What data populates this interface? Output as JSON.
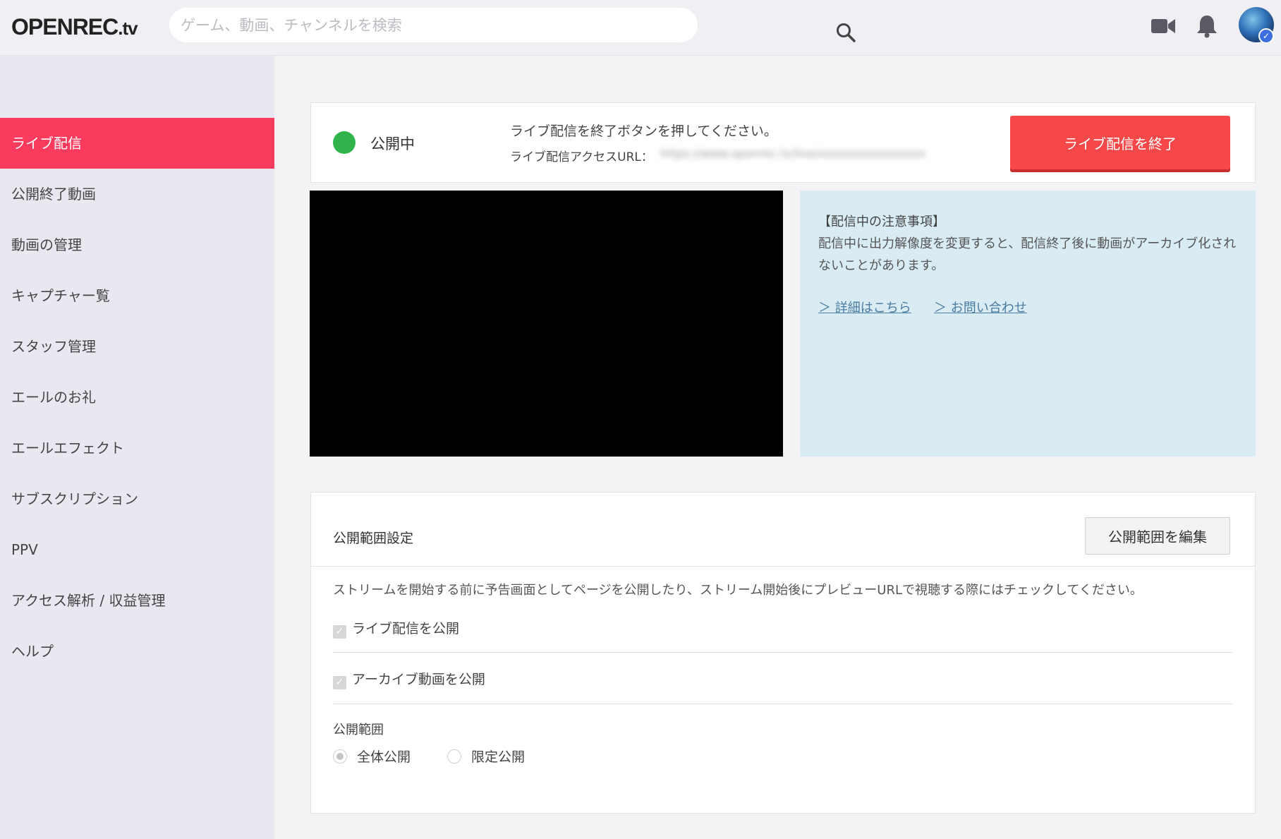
{
  "header": {
    "logo_main": "OPENREC",
    "logo_tld": ".tv",
    "search_placeholder": "ゲーム、動画、チャンネルを検索",
    "badge_check": "✓"
  },
  "sidebar": {
    "items": [
      {
        "label": "ライブ配信",
        "active": true
      },
      {
        "label": "公開終了動画"
      },
      {
        "label": "動画の管理"
      },
      {
        "label": "キャプチャー覧"
      },
      {
        "label": "スタッフ管理"
      },
      {
        "label": "エールのお礼"
      },
      {
        "label": "エールエフェクト"
      },
      {
        "label": "サブスクリプション"
      },
      {
        "label": "PPV"
      },
      {
        "label": "アクセス解析 / 収益管理"
      },
      {
        "label": "ヘルプ"
      }
    ]
  },
  "status": {
    "label": "公開中",
    "message": "ライブ配信を終了ボタンを押してください。",
    "url_label": "ライブ配信アクセスURL：",
    "url_value": "https://www.openrec.tv/live/xxxxxxxxxxxxxxxx",
    "end_button": "ライブ配信を終了",
    "status_color": "#2fb34a",
    "button_color": "#f64848"
  },
  "notice": {
    "title": "【配信中の注意事項】",
    "body": "配信中に出力解像度を変更すると、配信終了後に動画がアーカイブ化されないことがあります。",
    "link_details": "＞ 詳細はこちら",
    "link_contact": "＞ お問い合わせ"
  },
  "settings": {
    "title": "公開範囲設定",
    "edit_button": "公開範囲を編集",
    "description": "ストリームを開始する前に予告画面としてページを公開したり、ストリーム開始後にプレビューURLで視聴する際にはチェックしてください。",
    "check_live": {
      "label": "ライブ配信を公開",
      "checked": true
    },
    "check_archive": {
      "label": "アーカイブ動画を公開",
      "checked": true
    },
    "scope_label": "公開範囲",
    "radio_public": {
      "label": "全体公開",
      "selected": true
    },
    "radio_limited": {
      "label": "限定公開",
      "selected": false
    }
  },
  "colors": {
    "accent": "#fb3b5e",
    "notice_bg": "#d9ecf4"
  }
}
